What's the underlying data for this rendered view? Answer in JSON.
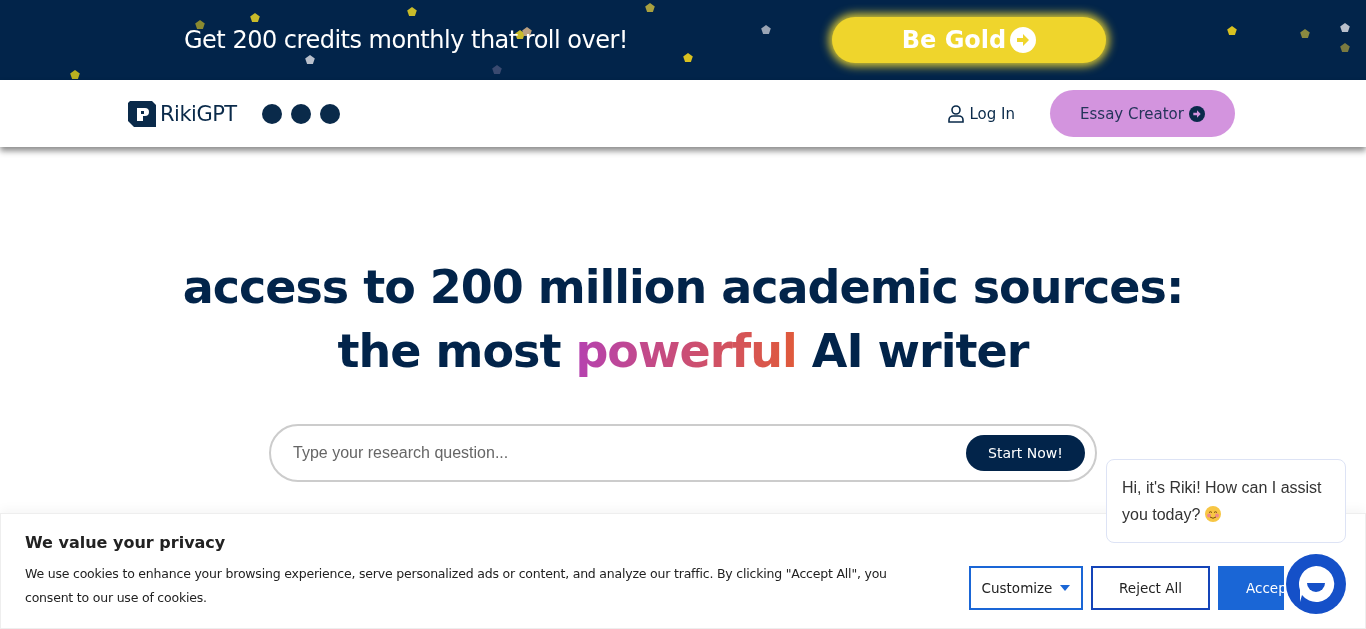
{
  "promo_banner": {
    "text": "Get 200 credits monthly that roll over!",
    "button": "Be Gold"
  },
  "header": {
    "logo": "RikiGPT",
    "login": "Log In",
    "cta": "Essay Creator"
  },
  "hero": {
    "line_1": "access to 200 million academic sources:",
    "line_2": {
      "before": "the most ",
      "highlight": "powerful",
      "after": " AI writer"
    }
  },
  "search": {
    "placeholder": "Type your research question...",
    "button": "Start Now!"
  },
  "cookie_banner": {
    "title": "We value your privacy",
    "text": "We use cookies to enhance your browsing experience, serve personalized ads or content, and analyze our traffic. By clicking \"Accept All\", you consent to our use of cookies.",
    "buttons": [
      {
        "kind": "dropdown",
        "label": "Customize"
      },
      {
        "kind": "outline",
        "label": "Reject All"
      },
      {
        "kind": "primary",
        "label": "Accep"
      }
    ]
  },
  "chat": {
    "message": "Hi, it's Riki! How can I assist you today?"
  }
}
